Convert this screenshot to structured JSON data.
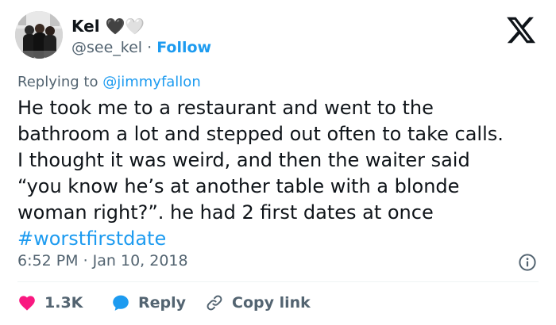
{
  "author": {
    "name": "Kel 🖤🤍",
    "handle": "@see_kel",
    "separator": "·",
    "follow_label": "Follow"
  },
  "reply_context": {
    "prefix": "Replying to",
    "mention": "@jimmyfallon"
  },
  "tweet": {
    "lines": [
      "He took me to a restaurant and went to the",
      "bathroom a lot and stepped out often to take calls.",
      "I thought it was weird, and then the waiter said",
      "“you know he’s at another table with a blonde",
      "woman right?”. he had 2 first dates at once"
    ],
    "hashtag": "#worstfirstdate"
  },
  "timestamp": "6:52 PM · Jan 10, 2018",
  "actions": {
    "like_count": "1.3K",
    "reply_label": "Reply",
    "copy_link_label": "Copy link"
  },
  "icons": {
    "brand": "x-logo-icon",
    "info": "info-icon",
    "like": "heart-icon",
    "reply": "reply-bubble-icon",
    "copy": "link-icon"
  },
  "colors": {
    "accent": "#1d9bf0",
    "like": "#f91880",
    "text": "#0f1419",
    "muted": "#536471",
    "divider": "#eff3f4"
  }
}
